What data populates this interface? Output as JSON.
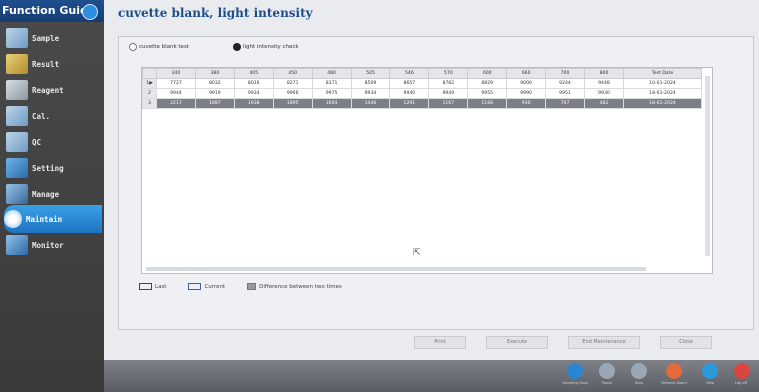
{
  "sidebar": {
    "title": "Function Guide",
    "items": [
      {
        "label": "Sample",
        "icon": "test-tube-icon"
      },
      {
        "label": "Result",
        "icon": "result-icon"
      },
      {
        "label": "Reagent",
        "icon": "reagent-icon"
      },
      {
        "label": "Cal.",
        "icon": "calibration-icon"
      },
      {
        "label": "QC",
        "icon": "qc-icon"
      },
      {
        "label": "Setting",
        "icon": "settings-icon"
      },
      {
        "label": "Manage",
        "icon": "manage-icon"
      },
      {
        "label": "Maintain",
        "icon": "maintain-icon",
        "active": true
      },
      {
        "label": "Monitor",
        "icon": "monitor-icon"
      }
    ]
  },
  "main": {
    "title": "cuvette blank, light intensity",
    "radio": {
      "cuvette_blank_test": "cuvette blank test",
      "light_intensity_check": "light intensity check",
      "selected": "light_intensity_check"
    },
    "table": {
      "columns": [
        "340",
        "380",
        "405",
        "450",
        "480",
        "505",
        "546",
        "570",
        "600",
        "660",
        "700",
        "800",
        "Test Date"
      ],
      "rows": [
        {
          "index": "1",
          "marker": "▶",
          "values": [
            "7727",
            "8032",
            "8016",
            "8271",
            "8371",
            "8509",
            "8657",
            "8782",
            "8829",
            "9000",
            "9244",
            "9448",
            "10-01-2024"
          ]
        },
        {
          "index": "2",
          "marker": "",
          "values": [
            "9944",
            "9919",
            "9934",
            "9966",
            "9975",
            "9934",
            "9940",
            "9949",
            "9955",
            "9990",
            "9951",
            "9930",
            "18-01-2024"
          ]
        },
        {
          "index": "3",
          "marker": "",
          "values": [
            "2217",
            "1887",
            "1938",
            "1895",
            "1604",
            "1446",
            "1291",
            "1167",
            "1166",
            "930",
            "707",
            "482",
            "18-01-2024"
          ]
        }
      ],
      "selected_row": 2
    },
    "legend": {
      "last": "Last",
      "current": "Current",
      "difference": "Difference between two times"
    },
    "buttons": {
      "print": "Print",
      "execute": "Execute",
      "end_maintenance": "End Maintenance",
      "close": "Close"
    }
  },
  "bottom": {
    "buttons": [
      {
        "label": "Sampling Stop",
        "color": "#2a86d0"
      },
      {
        "label": "Pause",
        "color": "#9aa7b6"
      },
      {
        "label": "Stop",
        "color": "#9aa7b6"
      },
      {
        "label": "Remove Alarm",
        "color": "#e26a3b"
      },
      {
        "label": "Help",
        "color": "#2a9ad8"
      },
      {
        "label": "Log off",
        "color": "#d8463f"
      }
    ]
  }
}
